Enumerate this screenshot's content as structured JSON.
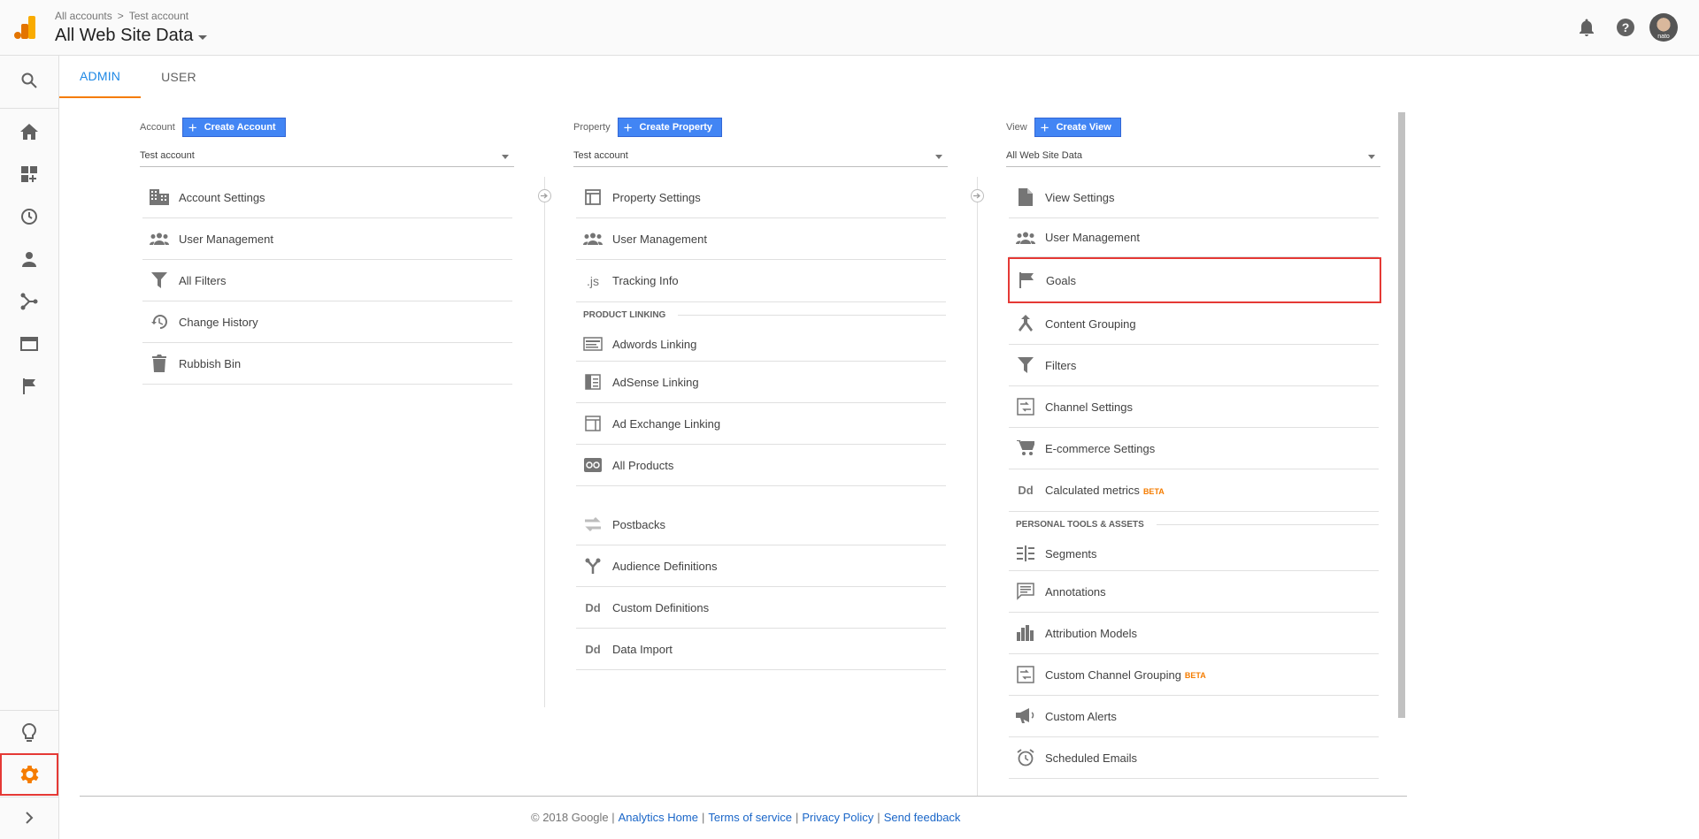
{
  "header": {
    "breadcrumb": {
      "account": "All accounts",
      "separator": ">",
      "property": "Test account"
    },
    "view_title": "All Web Site Data",
    "avatar_label": "nato",
    "icons": [
      "bell-icon",
      "help-icon"
    ]
  },
  "colors": {
    "brand_orange": "#f57c00",
    "primary_blue": "#4285f4",
    "link_blue": "#1a66c8",
    "highlight_red": "#e53935"
  },
  "leftnav": {
    "items": [
      "search-icon",
      "home-icon",
      "customization-icon",
      "realtime-icon",
      "audience-icon",
      "acquisition-icon",
      "behavior-icon",
      "conversions-icon",
      "discover-icon",
      "admin-gear-icon",
      "expand-icon"
    ]
  },
  "tabs": [
    {
      "label": "ADMIN",
      "active": true
    },
    {
      "label": "USER",
      "active": false
    }
  ],
  "account": {
    "label": "Account",
    "create_label": "Create Account",
    "selected": "Test account",
    "items": [
      {
        "label": "Account Settings",
        "icon": "building-icon"
      },
      {
        "label": "User Management",
        "icon": "people-icon"
      },
      {
        "label": "All Filters",
        "icon": "filter-icon"
      },
      {
        "label": "Change History",
        "icon": "history-icon"
      },
      {
        "label": "Rubbish Bin",
        "icon": "trash-icon"
      }
    ]
  },
  "property": {
    "label": "Property",
    "create_label": "Create Property",
    "selected": "Test account",
    "items": [
      {
        "label": "Property Settings",
        "icon": "window-icon"
      },
      {
        "label": "User Management",
        "icon": "people-icon"
      },
      {
        "label": "Tracking Info",
        "icon": "js-icon",
        "glyph": ".js"
      }
    ],
    "product_linking_heading": "PRODUCT LINKING",
    "linking_items": [
      {
        "label": "Adwords Linking",
        "icon": "adwords-icon"
      },
      {
        "label": "AdSense Linking",
        "icon": "adsense-icon"
      },
      {
        "label": "Ad Exchange Linking",
        "icon": "ad-exchange-icon"
      },
      {
        "label": "All Products",
        "icon": "all-products-icon"
      }
    ],
    "more_items": [
      {
        "label": "Postbacks",
        "icon": "postbacks-icon"
      },
      {
        "label": "Audience Definitions",
        "icon": "audience-def-icon"
      },
      {
        "label": "Custom Definitions",
        "icon": "dd-icon",
        "glyph": "Dd"
      },
      {
        "label": "Data Import",
        "icon": "dd-icon",
        "glyph": "Dd"
      }
    ]
  },
  "view": {
    "label": "View",
    "create_label": "Create View",
    "selected": "All Web Site Data",
    "items": [
      {
        "label": "View Settings",
        "icon": "document-icon"
      },
      {
        "label": "User Management",
        "icon": "people-icon"
      },
      {
        "label": "Goals",
        "icon": "flag-icon"
      },
      {
        "label": "Content Grouping",
        "icon": "content-grouping-icon"
      },
      {
        "label": "Filters",
        "icon": "filter-icon"
      },
      {
        "label": "Channel Settings",
        "icon": "channel-icon"
      },
      {
        "label": "E-commerce Settings",
        "icon": "cart-icon"
      },
      {
        "label": "Calculated metrics",
        "icon": "dd-icon",
        "glyph": "Dd",
        "badge": "BETA"
      }
    ],
    "personal_heading": "PERSONAL TOOLS & ASSETS",
    "personal_items": [
      {
        "label": "Segments",
        "icon": "segments-icon"
      },
      {
        "label": "Annotations",
        "icon": "annotations-icon"
      },
      {
        "label": "Attribution Models",
        "icon": "attribution-icon"
      },
      {
        "label": "Custom Channel Grouping",
        "icon": "channel-icon",
        "badge": "BETA"
      },
      {
        "label": "Custom Alerts",
        "icon": "megaphone-icon"
      },
      {
        "label": "Scheduled Emails",
        "icon": "alarm-icon"
      }
    ]
  },
  "footer": {
    "copyright": "© 2018 Google |",
    "links": [
      "Analytics Home",
      "Terms of service",
      "Privacy Policy",
      "Send feedback"
    ],
    "sep": "|"
  }
}
